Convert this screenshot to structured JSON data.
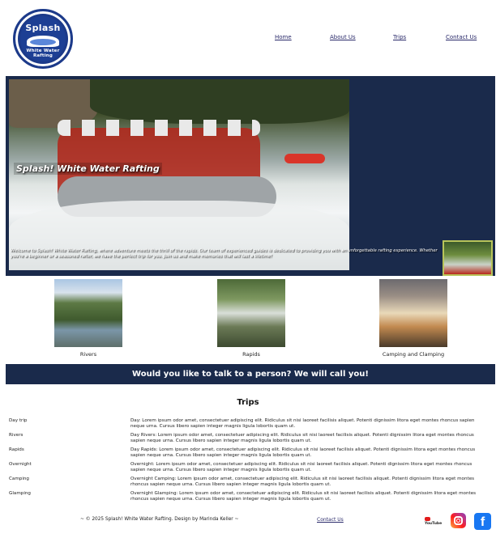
{
  "logo": {
    "top_text": "Splash",
    "bottom_text": "White Water Rafting"
  },
  "nav": {
    "items": [
      "Home",
      "About Us",
      "Trips",
      "Contact Us"
    ]
  },
  "hero": {
    "title": "Splash! White Water Rafting",
    "text": "Welcome to Splash! White Water Rafting, where adventure meets the thrill of the rapids. Our team of experienced guides is dedicated to providing you with an unforgettable rafting experience. Whether you're a beginner or a seasoned rafter, we have the perfect trip for you. Join us and make memories that will last a lifetime!"
  },
  "categories": [
    {
      "label": "Rivers"
    },
    {
      "label": "Rapids"
    },
    {
      "label": "Camping and Clamping"
    }
  ],
  "callbar": {
    "text": "Would you like to talk to a person? We will call you!"
  },
  "trips": {
    "title": "Trips",
    "rows": [
      {
        "name": "Day trip",
        "desc": "Day: Lorem ipsum odor amet, consectetuer adipiscing elit. Ridiculus sit nisi laoreet facilisis aliquet. Potenti dignissim litora eget montes rhoncus sapien neque urna. Cursus libero sapien integer magnis ligula lobortis quam ut."
      },
      {
        "name": "Rivers",
        "desc": "Day Rivers: Lorem ipsum odor amet, consectetuer adipiscing elit. Ridiculus sit nisi laoreet facilisis aliquet. Potenti dignissim litora eget montes rhoncus sapien neque urna. Cursus libero sapien integer magnis ligula lobortis quam ut."
      },
      {
        "name": "Rapids",
        "desc": "Day Rapids: Lorem ipsum odor amet, consectetuer adipiscing elit. Ridiculus sit nisi laoreet facilisis aliquet. Potenti dignissim litora eget montes rhoncus sapien neque urna. Cursus libero sapien integer magnis ligula lobortis quam ut."
      },
      {
        "name": "Overnight",
        "desc": "Overnight: Lorem ipsum odor amet, consectetuer adipiscing elit. Ridiculus sit nisi laoreet facilisis aliquet. Potenti dignissim litora eget montes rhoncus sapien neque urna. Cursus libero sapien integer magnis ligula lobortis quam ut."
      },
      {
        "name": "Camping",
        "desc": "Overnight Camping: Lorem ipsum odor amet, consectetuer adipiscing elit. Ridiculus sit nisi laoreet facilisis aliquet. Potenti dignissim litora eget montes rhoncus sapien neque urna. Cursus libero sapien integer magnis ligula lobortis quam ut."
      },
      {
        "name": "Glamping",
        "desc": "Overnight Glamping: Lorem ipsum odor amet, consectetuer adipiscing elit. Ridiculus sit nisi laoreet facilisis aliquet. Potenti dignissim litora eget montes rhoncus sapien neque urna. Cursus libero sapien integer magnis ligula lobortis quam ut."
      }
    ]
  },
  "footer": {
    "copyright": "~ © 2025 Splash! White Water Rafting. Design by Marinda Keller ~",
    "contact": "Contact Us",
    "youtube": "YouTube",
    "facebook_glyph": "f"
  },
  "colors": {
    "navy": "#1a2a4b",
    "logo_blue": "#1c3a8a"
  }
}
